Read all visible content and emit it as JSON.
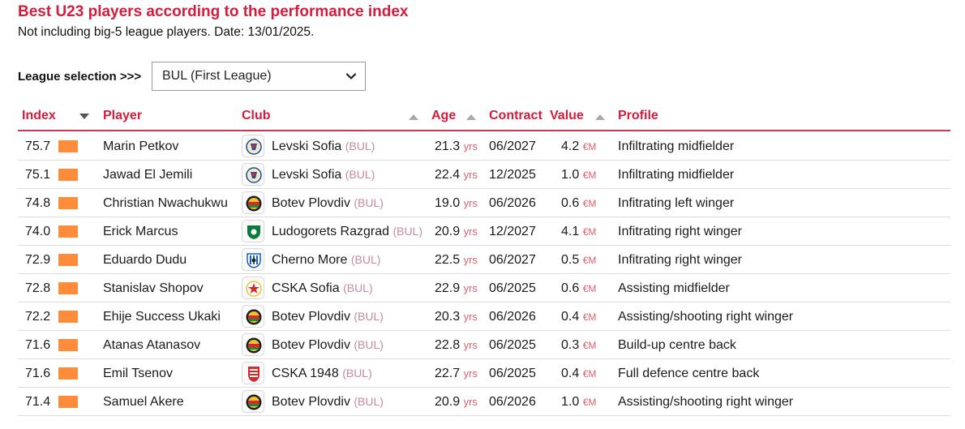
{
  "title": "Best U23 players according to the performance index",
  "subtitle": "Not including big-5 league players. Date: 13/01/2025.",
  "league": {
    "label": "League selection >>>",
    "selected": "BUL (First League)"
  },
  "columns": {
    "index": "Index",
    "player": "Player",
    "club": "Club",
    "age": "Age",
    "contract": "Contract",
    "value": "Value",
    "profile": "Profile"
  },
  "units": {
    "age": "yrs",
    "value": "€M"
  },
  "colors": {
    "accent": "#d41c3c",
    "bar": "#ff8c3a"
  },
  "rows": [
    {
      "index": "75.7",
      "player": "Marin Petkov",
      "club": "Levski Sofia",
      "country": "(BUL)",
      "crest": "levski-crest-icon",
      "age": "21.3",
      "contract": "06/2027",
      "value": "4.2",
      "profile": "Infiltrating midfielder"
    },
    {
      "index": "75.1",
      "player": "Jawad El Jemili",
      "club": "Levski Sofia",
      "country": "(BUL)",
      "crest": "levski-crest-icon",
      "age": "22.4",
      "contract": "12/2025",
      "value": "1.0",
      "profile": "Infiltrating midfielder"
    },
    {
      "index": "74.8",
      "player": "Christian Nwachukwu",
      "club": "Botev Plovdiv",
      "country": "(BUL)",
      "crest": "botev-crest-icon",
      "age": "19.0",
      "contract": "06/2026",
      "value": "0.6",
      "profile": "Infitrating left winger"
    },
    {
      "index": "74.0",
      "player": "Erick Marcus",
      "club": "Ludogorets Razgrad",
      "country": "(BUL)",
      "crest": "ludogorets-crest-icon",
      "age": "20.9",
      "contract": "12/2027",
      "value": "4.1",
      "profile": "Infitrating right winger"
    },
    {
      "index": "72.9",
      "player": "Eduardo Dudu",
      "club": "Cherno More",
      "country": "(BUL)",
      "crest": "cherno-more-crest-icon",
      "age": "22.5",
      "contract": "06/2027",
      "value": "0.5",
      "profile": "Infitrating right winger"
    },
    {
      "index": "72.8",
      "player": "Stanislav Shopov",
      "club": "CSKA Sofia",
      "country": "(BUL)",
      "crest": "cska-sofia-crest-icon",
      "age": "22.9",
      "contract": "06/2025",
      "value": "0.6",
      "profile": "Assisting midfielder"
    },
    {
      "index": "72.2",
      "player": "Ehije Success Ukaki",
      "club": "Botev Plovdiv",
      "country": "(BUL)",
      "crest": "botev-crest-icon",
      "age": "20.3",
      "contract": "06/2026",
      "value": "0.4",
      "profile": "Assisting/shooting right winger"
    },
    {
      "index": "71.6",
      "player": "Atanas Atanasov",
      "club": "Botev Plovdiv",
      "country": "(BUL)",
      "crest": "botev-crest-icon",
      "age": "22.8",
      "contract": "06/2025",
      "value": "0.3",
      "profile": "Build-up centre back"
    },
    {
      "index": "71.6",
      "player": "Emil Tsenov",
      "club": "CSKA 1948",
      "country": "(BUL)",
      "crest": "cska-1948-crest-icon",
      "age": "22.7",
      "contract": "06/2025",
      "value": "0.4",
      "profile": "Full defence centre back"
    },
    {
      "index": "71.4",
      "player": "Samuel Akere",
      "club": "Botev Plovdiv",
      "country": "(BUL)",
      "crest": "botev-crest-icon",
      "age": "20.9",
      "contract": "06/2026",
      "value": "1.0",
      "profile": "Assisting/shooting right winger"
    }
  ]
}
